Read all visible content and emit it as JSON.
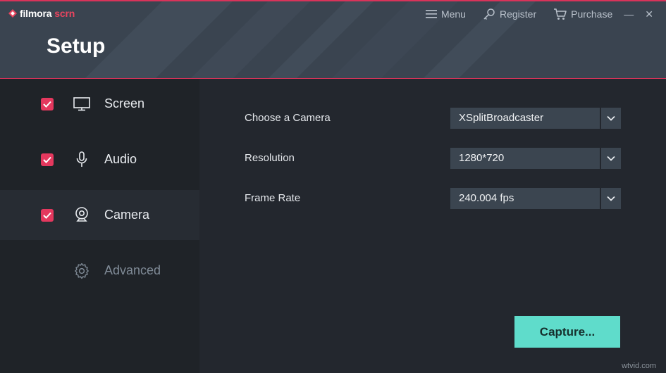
{
  "app": {
    "brand": "filmora",
    "brand_suffix": "scrn",
    "page_title": "Setup"
  },
  "top_bar": {
    "menu_label": "Menu",
    "register_label": "Register",
    "purchase_label": "Purchase",
    "minimize_glyph": "—",
    "close_glyph": "✕"
  },
  "sidebar": {
    "items": [
      {
        "label": "Screen",
        "icon": "monitor-icon",
        "checked": true,
        "active": false
      },
      {
        "label": "Audio",
        "icon": "microphone-icon",
        "checked": true,
        "active": false
      },
      {
        "label": "Camera",
        "icon": "webcam-icon",
        "checked": true,
        "active": true
      },
      {
        "label": "Advanced",
        "icon": "gear-icon",
        "checked": false,
        "active": false
      }
    ]
  },
  "camera_settings": {
    "camera": {
      "label": "Choose a Camera",
      "value": "XSplitBroadcaster"
    },
    "resolution": {
      "label": "Resolution",
      "value": "1280*720"
    },
    "frame_rate": {
      "label": "Frame Rate",
      "value": "240.004 fps"
    }
  },
  "actions": {
    "capture_label": "Capture..."
  },
  "watermark": "wtvid.com",
  "colors": {
    "accent": "#e4385e",
    "capture": "#5fdccb",
    "header": "#3a4450",
    "background": "#1e2228"
  }
}
